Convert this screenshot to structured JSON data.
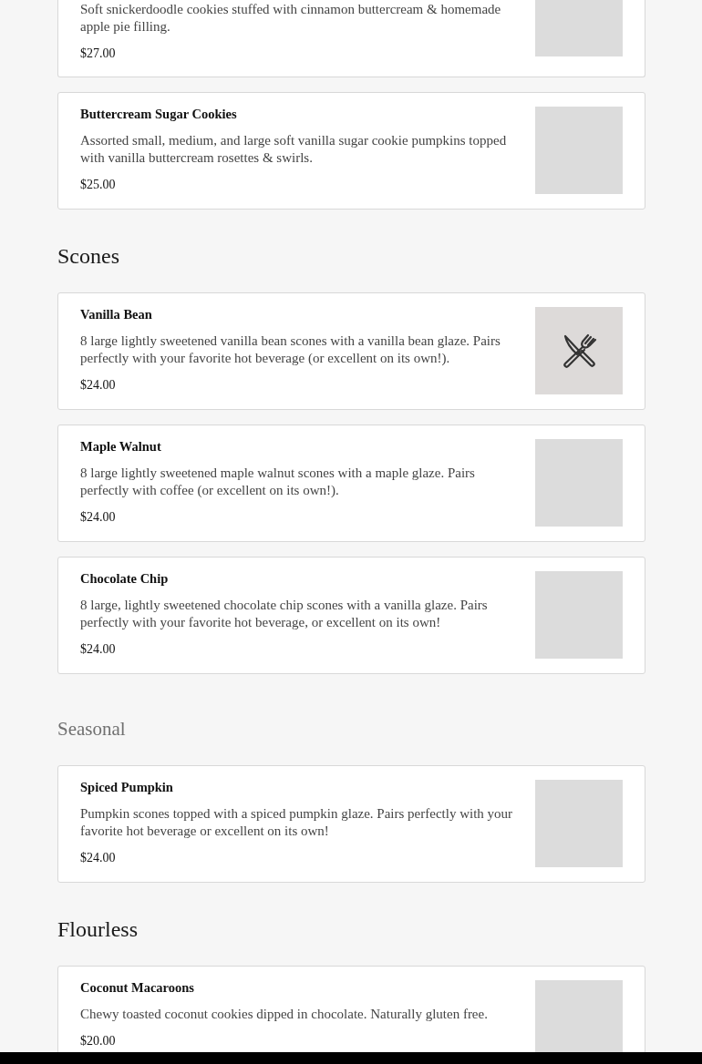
{
  "sections": [
    {
      "items": [
        {
          "description": "Soft snickerdoodle cookies stuffed with cinnamon buttercream & homemade apple pie filling.",
          "price": "$27.00",
          "kind": "blank"
        },
        {
          "name": "Buttercream Sugar Cookies",
          "description": "Assorted small, medium, and large soft vanilla sugar cookie pumpkins topped with vanilla buttercream rosettes & swirls.",
          "price": "$25.00",
          "kind": "blank"
        }
      ]
    },
    {
      "heading": "Scones",
      "muted": false,
      "items": [
        {
          "name": "Vanilla Bean",
          "description": "8 large lightly sweetened vanilla bean scones with a vanilla bean glaze. Pairs perfectly with your favorite hot beverage (or excellent on its own!).",
          "price": "$24.00",
          "kind": "icon"
        },
        {
          "name": "Maple Walnut",
          "description": "8 large lightly sweetened maple walnut scones with a maple glaze. Pairs perfectly with coffee (or excellent on its own!).",
          "price": "$24.00",
          "kind": "blank"
        },
        {
          "name": "Chocolate Chip",
          "description": "8 large, lightly sweetened chocolate chip scones with a vanilla glaze. Pairs perfectly with your favorite hot beverage, or excellent on its own!",
          "price": "$24.00",
          "kind": "blank"
        }
      ]
    },
    {
      "heading": "Seasonal",
      "muted": true,
      "items": [
        {
          "name": "Spiced Pumpkin",
          "description": "Pumpkin scones topped with a spiced pumpkin glaze. Pairs perfectly with your favorite hot beverage or excellent on its own!",
          "price": "$24.00",
          "kind": "blank"
        }
      ]
    },
    {
      "heading": "Flourless",
      "muted": false,
      "items": [
        {
          "name": "Coconut Macaroons",
          "description": "Chewy toasted coconut cookies dipped in chocolate. Naturally gluten free.",
          "price": "$20.00",
          "kind": "blank"
        }
      ]
    }
  ]
}
